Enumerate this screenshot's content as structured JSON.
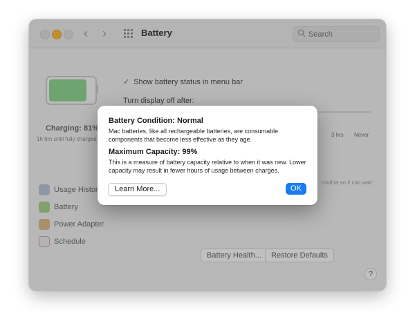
{
  "window": {
    "title": "Battery",
    "search": {
      "placeholder": "Search"
    }
  },
  "battery_panel": {
    "charging_status": "Charging: 81%",
    "charging_detail": "1h 6m until fully charged"
  },
  "settings": {
    "show_status_label": "Show battery status in menu bar",
    "show_status_checked": true,
    "turn_off_label": "Turn display off after:",
    "ticks": {
      "three_hrs": "3 hrs",
      "never": "Never"
    },
    "hint_right": "routine so it can wait"
  },
  "sidebar": {
    "items": [
      {
        "label": "Usage History",
        "icon": "usage-history-icon"
      },
      {
        "label": "Battery",
        "icon": "battery-icon"
      },
      {
        "label": "Power Adapter",
        "icon": "power-adapter-icon"
      },
      {
        "label": "Schedule",
        "icon": "schedule-icon"
      }
    ]
  },
  "footer": {
    "battery_health_label": "Battery Health...",
    "restore_defaults_label": "Restore Defaults",
    "help_label": "?"
  },
  "dialog": {
    "heading1": "Battery Condition: Normal",
    "text1": "Mac batteries, like all rechargeable batteries, are consumable components that become less effective as they age.",
    "heading2": "Maximum Capacity: 99%",
    "text2": "This is a measure of battery capacity relative to when it was new. Lower capacity may result in fewer hours of usage between charges.",
    "learn_more_label": "Learn More...",
    "ok_label": "OK"
  },
  "colors": {
    "accent": "#1a7cf0",
    "battery_fill": "#8fd18f",
    "traffic_yellow": "#f6b83e"
  }
}
